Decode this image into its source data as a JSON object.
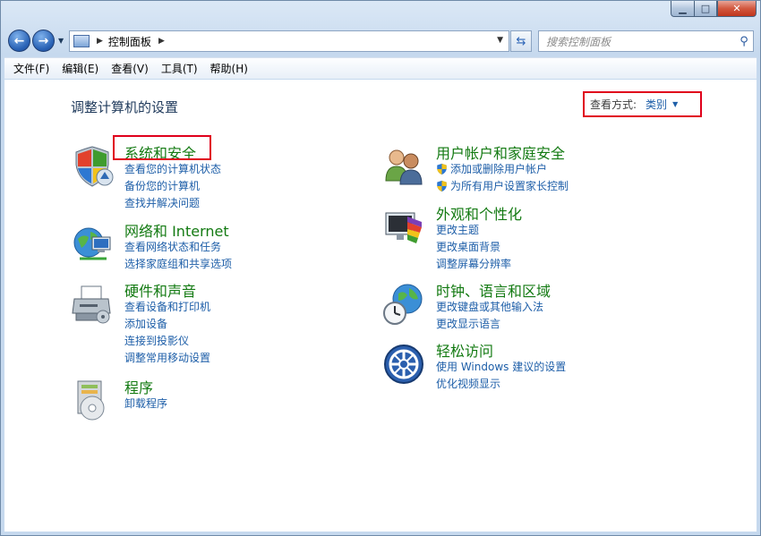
{
  "window": {
    "title": "控制面板",
    "controls": {
      "minimize": "▁",
      "maximize": "□",
      "close": "✕"
    }
  },
  "address": {
    "path": "控制面板",
    "back_icon": "back-arrow-icon",
    "forward_icon": "forward-arrow-icon"
  },
  "search": {
    "placeholder": "搜索控制面板"
  },
  "menu": [
    {
      "label": "文件(F)"
    },
    {
      "label": "编辑(E)"
    },
    {
      "label": "查看(V)"
    },
    {
      "label": "工具(T)"
    },
    {
      "label": "帮助(H)"
    }
  ],
  "page": {
    "title": "调整计算机的设置"
  },
  "view_by": {
    "label": "查看方式:",
    "value": "类别"
  },
  "categories": {
    "system": {
      "title": "系统和安全",
      "links": [
        "查看您的计算机状态",
        "备份您的计算机",
        "查找并解决问题"
      ]
    },
    "network": {
      "title": "网络和 Internet",
      "links": [
        "查看网络状态和任务",
        "选择家庭组和共享选项"
      ]
    },
    "hardware": {
      "title": "硬件和声音",
      "links": [
        "查看设备和打印机",
        "添加设备",
        "连接到投影仪",
        "调整常用移动设置"
      ]
    },
    "programs": {
      "title": "程序",
      "links": [
        "卸载程序"
      ]
    },
    "users": {
      "title": "用户帐户和家庭安全",
      "links": [
        "添加或删除用户帐户",
        "为所有用户设置家长控制"
      ]
    },
    "appearance": {
      "title": "外观和个性化",
      "links": [
        "更改主题",
        "更改桌面背景",
        "调整屏幕分辨率"
      ]
    },
    "clock": {
      "title": "时钟、语言和区域",
      "links": [
        "更改键盘或其他输入法",
        "更改显示语言"
      ]
    },
    "access": {
      "title": "轻松访问",
      "links": [
        "使用 Windows 建议的设置",
        "优化视频显示"
      ]
    }
  },
  "colors": {
    "category_title": "#137a12",
    "link": "#1d5ea8",
    "highlight": "#e0001b"
  }
}
